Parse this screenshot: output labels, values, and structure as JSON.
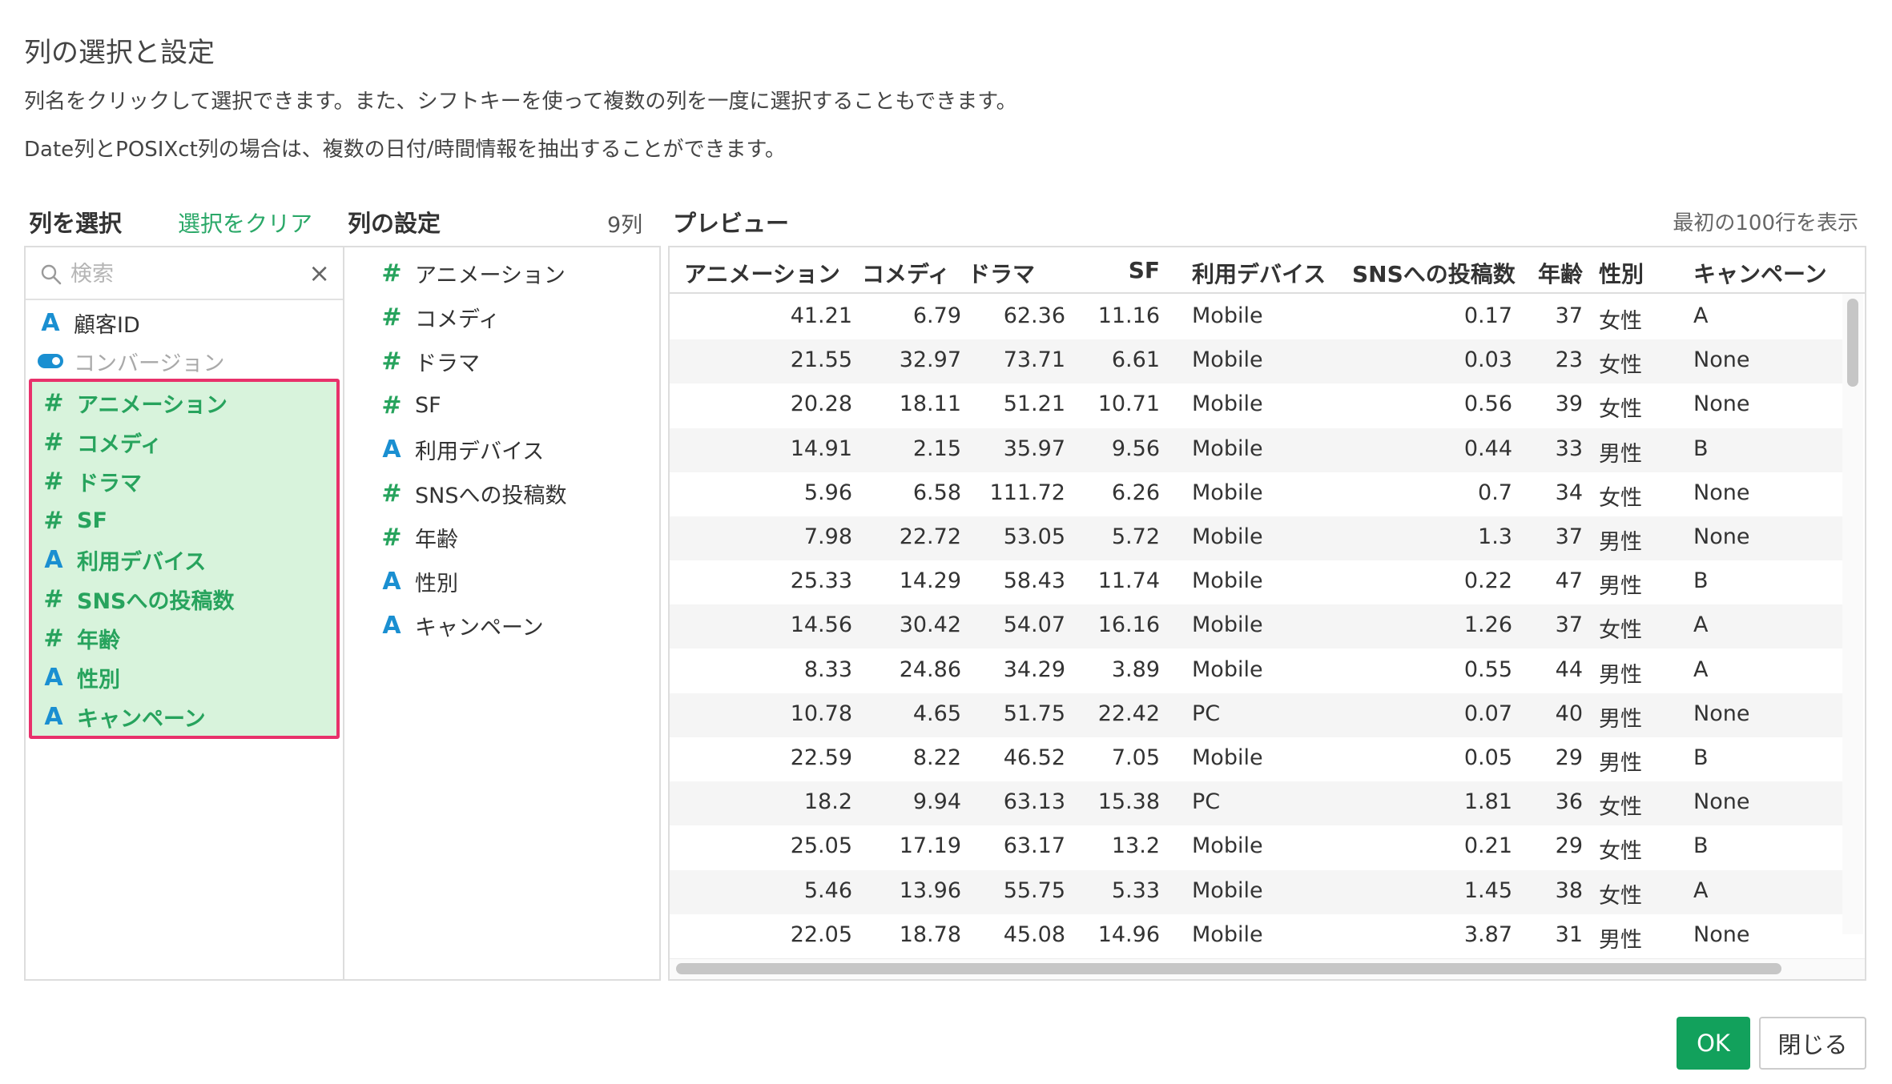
{
  "dialog": {
    "title": "列の選択と設定",
    "description_1": "列名をクリックして選択できます。また、シフトキーを使って複数の列を一度に選択することもできます。",
    "description_2": "Date列とPOSIXct列の場合は、複数の日付/時間情報を抽出することができます。"
  },
  "select_panel": {
    "header": "列を選択",
    "clear_link": "選択をクリア",
    "search_placeholder": "検索",
    "search_clear": "×",
    "unselected_items": [
      {
        "type_icon": "A",
        "label": "顧客ID"
      },
      {
        "type_icon": "toggle-icon",
        "label": "コンバージョン"
      }
    ],
    "selected_items": [
      {
        "type_icon": "#",
        "label": "アニメーション"
      },
      {
        "type_icon": "#",
        "label": "コメディ"
      },
      {
        "type_icon": "#",
        "label": "ドラマ"
      },
      {
        "type_icon": "#",
        "label": "SF"
      },
      {
        "type_icon": "A",
        "label": "利用デバイス"
      },
      {
        "type_icon": "#",
        "label": "SNSへの投稿数"
      },
      {
        "type_icon": "#",
        "label": "年齢"
      },
      {
        "type_icon": "A",
        "label": "性別"
      },
      {
        "type_icon": "A",
        "label": "キャンペーン"
      }
    ]
  },
  "settings_panel": {
    "header": "列の設定",
    "count": "9列",
    "items": [
      {
        "type_icon": "#",
        "label": "アニメーション"
      },
      {
        "type_icon": "#",
        "label": "コメディ"
      },
      {
        "type_icon": "#",
        "label": "ドラマ"
      },
      {
        "type_icon": "#",
        "label": "SF"
      },
      {
        "type_icon": "A",
        "label": "利用デバイス"
      },
      {
        "type_icon": "#",
        "label": "SNSへの投稿数"
      },
      {
        "type_icon": "#",
        "label": "年齢"
      },
      {
        "type_icon": "A",
        "label": "性別"
      },
      {
        "type_icon": "A",
        "label": "キャンペーン"
      }
    ]
  },
  "preview": {
    "header": "プレビュー",
    "note": "最初の100行を表示",
    "columns": [
      "アニメーション",
      "コメディ",
      "ドラマ",
      "SF",
      "利用デバイス",
      "SNSへの投稿数",
      "年齢",
      "性別",
      "キャンペーン"
    ],
    "rows": [
      [
        "41.21",
        "6.79",
        "62.36",
        "11.16",
        "Mobile",
        "0.17",
        "37",
        "女性",
        "A"
      ],
      [
        "21.55",
        "32.97",
        "73.71",
        "6.61",
        "Mobile",
        "0.03",
        "23",
        "女性",
        "None"
      ],
      [
        "20.28",
        "18.11",
        "51.21",
        "10.71",
        "Mobile",
        "0.56",
        "39",
        "女性",
        "None"
      ],
      [
        "14.91",
        "2.15",
        "35.97",
        "9.56",
        "Mobile",
        "0.44",
        "33",
        "男性",
        "B"
      ],
      [
        "5.96",
        "6.58",
        "111.72",
        "6.26",
        "Mobile",
        "0.7",
        "34",
        "女性",
        "None"
      ],
      [
        "7.98",
        "22.72",
        "53.05",
        "5.72",
        "Mobile",
        "1.3",
        "37",
        "男性",
        "None"
      ],
      [
        "25.33",
        "14.29",
        "58.43",
        "11.74",
        "Mobile",
        "0.22",
        "47",
        "男性",
        "B"
      ],
      [
        "14.56",
        "30.42",
        "54.07",
        "16.16",
        "Mobile",
        "1.26",
        "37",
        "女性",
        "A"
      ],
      [
        "8.33",
        "24.86",
        "34.29",
        "3.89",
        "Mobile",
        "0.55",
        "44",
        "男性",
        "A"
      ],
      [
        "10.78",
        "4.65",
        "51.75",
        "22.42",
        "PC",
        "0.07",
        "40",
        "男性",
        "None"
      ],
      [
        "22.59",
        "8.22",
        "46.52",
        "7.05",
        "Mobile",
        "0.05",
        "29",
        "男性",
        "B"
      ],
      [
        "18.2",
        "9.94",
        "63.13",
        "15.38",
        "PC",
        "1.81",
        "36",
        "女性",
        "None"
      ],
      [
        "25.05",
        "17.19",
        "63.17",
        "13.2",
        "Mobile",
        "0.21",
        "29",
        "女性",
        "B"
      ],
      [
        "5.46",
        "13.96",
        "55.75",
        "5.33",
        "Mobile",
        "1.45",
        "38",
        "女性",
        "A"
      ],
      [
        "22.05",
        "18.78",
        "45.08",
        "14.96",
        "Mobile",
        "3.87",
        "31",
        "男性",
        "None"
      ]
    ]
  },
  "footer": {
    "ok_label": "OK",
    "close_label": "閉じる"
  },
  "colors": {
    "accent_green": "#12a15c",
    "selection_border": "#e8316b",
    "selection_fill": "#d8f3dc",
    "type_a_blue": "#1a8fd1",
    "type_num_green": "#27a35d"
  }
}
